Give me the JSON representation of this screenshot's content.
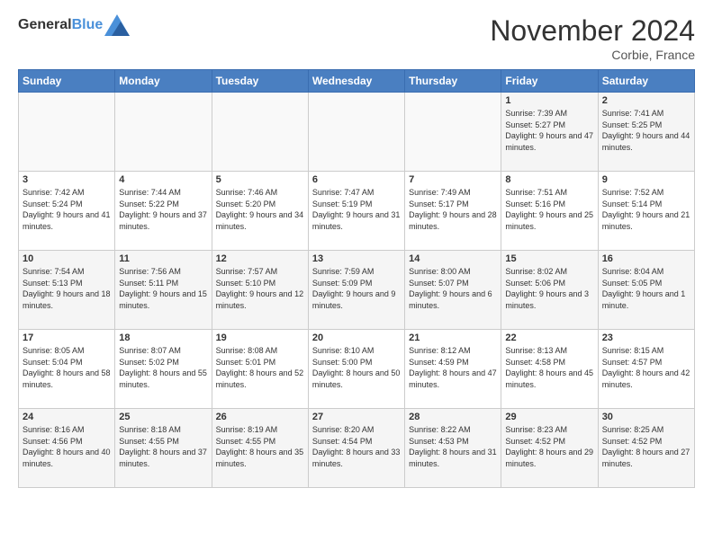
{
  "logo": {
    "text_general": "General",
    "text_blue": "Blue"
  },
  "header": {
    "month_title": "November 2024",
    "location": "Corbie, France"
  },
  "weekdays": [
    "Sunday",
    "Monday",
    "Tuesday",
    "Wednesday",
    "Thursday",
    "Friday",
    "Saturday"
  ],
  "weeks": [
    [
      {
        "day": "",
        "info": ""
      },
      {
        "day": "",
        "info": ""
      },
      {
        "day": "",
        "info": ""
      },
      {
        "day": "",
        "info": ""
      },
      {
        "day": "",
        "info": ""
      },
      {
        "day": "1",
        "info": "Sunrise: 7:39 AM\nSunset: 5:27 PM\nDaylight: 9 hours and 47 minutes."
      },
      {
        "day": "2",
        "info": "Sunrise: 7:41 AM\nSunset: 5:25 PM\nDaylight: 9 hours and 44 minutes."
      }
    ],
    [
      {
        "day": "3",
        "info": "Sunrise: 7:42 AM\nSunset: 5:24 PM\nDaylight: 9 hours and 41 minutes."
      },
      {
        "day": "4",
        "info": "Sunrise: 7:44 AM\nSunset: 5:22 PM\nDaylight: 9 hours and 37 minutes."
      },
      {
        "day": "5",
        "info": "Sunrise: 7:46 AM\nSunset: 5:20 PM\nDaylight: 9 hours and 34 minutes."
      },
      {
        "day": "6",
        "info": "Sunrise: 7:47 AM\nSunset: 5:19 PM\nDaylight: 9 hours and 31 minutes."
      },
      {
        "day": "7",
        "info": "Sunrise: 7:49 AM\nSunset: 5:17 PM\nDaylight: 9 hours and 28 minutes."
      },
      {
        "day": "8",
        "info": "Sunrise: 7:51 AM\nSunset: 5:16 PM\nDaylight: 9 hours and 25 minutes."
      },
      {
        "day": "9",
        "info": "Sunrise: 7:52 AM\nSunset: 5:14 PM\nDaylight: 9 hours and 21 minutes."
      }
    ],
    [
      {
        "day": "10",
        "info": "Sunrise: 7:54 AM\nSunset: 5:13 PM\nDaylight: 9 hours and 18 minutes."
      },
      {
        "day": "11",
        "info": "Sunrise: 7:56 AM\nSunset: 5:11 PM\nDaylight: 9 hours and 15 minutes."
      },
      {
        "day": "12",
        "info": "Sunrise: 7:57 AM\nSunset: 5:10 PM\nDaylight: 9 hours and 12 minutes."
      },
      {
        "day": "13",
        "info": "Sunrise: 7:59 AM\nSunset: 5:09 PM\nDaylight: 9 hours and 9 minutes."
      },
      {
        "day": "14",
        "info": "Sunrise: 8:00 AM\nSunset: 5:07 PM\nDaylight: 9 hours and 6 minutes."
      },
      {
        "day": "15",
        "info": "Sunrise: 8:02 AM\nSunset: 5:06 PM\nDaylight: 9 hours and 3 minutes."
      },
      {
        "day": "16",
        "info": "Sunrise: 8:04 AM\nSunset: 5:05 PM\nDaylight: 9 hours and 1 minute."
      }
    ],
    [
      {
        "day": "17",
        "info": "Sunrise: 8:05 AM\nSunset: 5:04 PM\nDaylight: 8 hours and 58 minutes."
      },
      {
        "day": "18",
        "info": "Sunrise: 8:07 AM\nSunset: 5:02 PM\nDaylight: 8 hours and 55 minutes."
      },
      {
        "day": "19",
        "info": "Sunrise: 8:08 AM\nSunset: 5:01 PM\nDaylight: 8 hours and 52 minutes."
      },
      {
        "day": "20",
        "info": "Sunrise: 8:10 AM\nSunset: 5:00 PM\nDaylight: 8 hours and 50 minutes."
      },
      {
        "day": "21",
        "info": "Sunrise: 8:12 AM\nSunset: 4:59 PM\nDaylight: 8 hours and 47 minutes."
      },
      {
        "day": "22",
        "info": "Sunrise: 8:13 AM\nSunset: 4:58 PM\nDaylight: 8 hours and 45 minutes."
      },
      {
        "day": "23",
        "info": "Sunrise: 8:15 AM\nSunset: 4:57 PM\nDaylight: 8 hours and 42 minutes."
      }
    ],
    [
      {
        "day": "24",
        "info": "Sunrise: 8:16 AM\nSunset: 4:56 PM\nDaylight: 8 hours and 40 minutes."
      },
      {
        "day": "25",
        "info": "Sunrise: 8:18 AM\nSunset: 4:55 PM\nDaylight: 8 hours and 37 minutes."
      },
      {
        "day": "26",
        "info": "Sunrise: 8:19 AM\nSunset: 4:55 PM\nDaylight: 8 hours and 35 minutes."
      },
      {
        "day": "27",
        "info": "Sunrise: 8:20 AM\nSunset: 4:54 PM\nDaylight: 8 hours and 33 minutes."
      },
      {
        "day": "28",
        "info": "Sunrise: 8:22 AM\nSunset: 4:53 PM\nDaylight: 8 hours and 31 minutes."
      },
      {
        "day": "29",
        "info": "Sunrise: 8:23 AM\nSunset: 4:52 PM\nDaylight: 8 hours and 29 minutes."
      },
      {
        "day": "30",
        "info": "Sunrise: 8:25 AM\nSunset: 4:52 PM\nDaylight: 8 hours and 27 minutes."
      }
    ]
  ]
}
